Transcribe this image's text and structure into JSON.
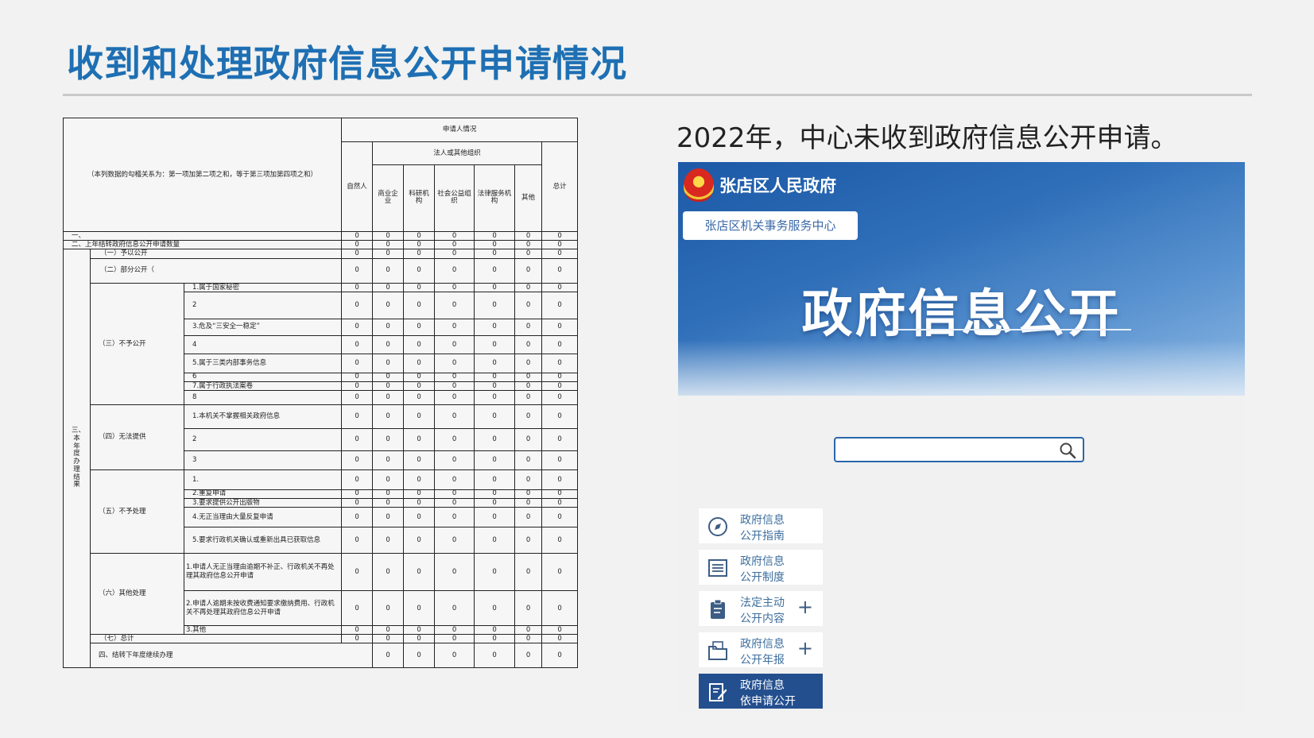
{
  "slide": {
    "title": "收到和处理政府信息公开申请情况",
    "subtitle": "2022年，中心未收到政府信息公开申请。"
  },
  "table": {
    "header": {
      "applicant_situation": "申请人情况",
      "note": "（本列数据的勾稽关系为：第一项加第二项之和，等于第三项加第四项之和）",
      "natural_person": "自然人",
      "legal_group": "法人或其他组织",
      "commercial": "商业企业",
      "research": "科研机构",
      "social": "社会公益组织",
      "legal_service": "法律服务机构",
      "other": "其他",
      "total": "总计"
    },
    "labels": {
      "r1": "一、",
      "r2": "二、上年结转政府信息公开申请数量",
      "section3": "三、本年度办理结果",
      "g1": "（一）予以公开",
      "g2": "（二）部分公开（",
      "g3": "（三）不予公开",
      "g3_1": "1.属于国家秘密",
      "g3_2": "2",
      "g3_3": "3.危及“三安全一稳定”",
      "g3_4": "4",
      "g3_5": "5.属于三类内部事务信息",
      "g3_6": "6",
      "g3_7": "7.属于行政执法案卷",
      "g3_8": "8",
      "g4": "（四）无法提供",
      "g4_1": "1.本机关不掌握相关政府信息",
      "g4_2": "2",
      "g4_3": "3",
      "g5": "（五）不予处理",
      "g5_1": "1.",
      "g5_2": "2.重复申请",
      "g5_3": "3.要求提供公开出版物",
      "g5_4": "4.无正当理由大量反复申请",
      "g5_5": "5.要求行政机关确认或重新出具已获取信息",
      "g6": "（六）其他处理",
      "g6_1": "1.申请人无正当理由逾期不补正、行政机关不再处理其政府信息公开申请",
      "g6_2": "2.申请人逾期未按收费通知要求缴纳费用、行政机关不再处理其政府信息公开申请",
      "g6_3": "3.其他",
      "g7": "（七）总计",
      "r4": "四、结转下年度继续办理"
    },
    "values": {
      "r1": [
        "0",
        "0",
        "0",
        "0",
        "0",
        "0",
        "0"
      ],
      "r2": [
        "0",
        "0",
        "0",
        "0",
        "0",
        "0",
        "0"
      ],
      "g1": [
        "0",
        "0",
        "0",
        "0",
        "0",
        "0",
        "0"
      ],
      "g2": [
        "0",
        "0",
        "0",
        "0",
        "0",
        "0",
        "0"
      ],
      "g3_1": [
        "0",
        "0",
        "0",
        "0",
        "0",
        "0",
        "0"
      ],
      "g3_2": [
        "0",
        "0",
        "0",
        "0",
        "0",
        "0",
        "0"
      ],
      "g3_3": [
        "0",
        "0",
        "0",
        "0",
        "0",
        "0",
        "0"
      ],
      "g3_4": [
        "0",
        "0",
        "0",
        "0",
        "0",
        "0",
        "0"
      ],
      "g3_5": [
        "0",
        "0",
        "0",
        "0",
        "0",
        "0",
        "0"
      ],
      "g3_6": [
        "0",
        "0",
        "0",
        "0",
        "0",
        "0",
        "0"
      ],
      "g3_7": [
        "0",
        "0",
        "0",
        "0",
        "0",
        "0",
        "0"
      ],
      "g3_8": [
        "0",
        "0",
        "0",
        "0",
        "0",
        "0",
        "0"
      ],
      "g4_1": [
        "0",
        "0",
        "0",
        "0",
        "0",
        "0",
        "0"
      ],
      "g4_2": [
        "0",
        "0",
        "0",
        "0",
        "0",
        "0",
        "0"
      ],
      "g4_3": [
        "0",
        "0",
        "0",
        "0",
        "0",
        "0",
        "0"
      ],
      "g5_1": [
        "0",
        "0",
        "0",
        "0",
        "0",
        "0",
        "0"
      ],
      "g5_2": [
        "0",
        "0",
        "0",
        "0",
        "0",
        "0",
        "0"
      ],
      "g5_3": [
        "0",
        "0",
        "0",
        "0",
        "0",
        "0",
        "0"
      ],
      "g5_4": [
        "0",
        "0",
        "0",
        "0",
        "0",
        "0",
        "0"
      ],
      "g5_5": [
        "0",
        "0",
        "0",
        "0",
        "0",
        "0",
        "0"
      ],
      "g6_1": [
        "0",
        "0",
        "0",
        "0",
        "0",
        "0",
        "0"
      ],
      "g6_2": [
        "0",
        "0",
        "0",
        "0",
        "0",
        "0",
        "0"
      ],
      "g6_3": [
        "0",
        "0",
        "0",
        "0",
        "0",
        "0",
        "0"
      ],
      "g7": [
        "0",
        "0",
        "0",
        "0",
        "0",
        "0",
        "0"
      ],
      "r4": [
        "0",
        "0",
        "0",
        "0",
        "0",
        "0",
        "0"
      ]
    }
  },
  "website": {
    "gov_name": "张店区人民政府",
    "org_name": "张店区机关事务服务中心",
    "banner_title": "政府信息公开",
    "search": {
      "placeholder": "",
      "icon": "search-icon"
    },
    "menu": [
      {
        "l1": "政府信息",
        "l2": "公开指南",
        "icon": "compass-icon",
        "plus": "",
        "active": false
      },
      {
        "l1": "政府信息",
        "l2": "公开制度",
        "icon": "list-icon",
        "plus": "",
        "active": false
      },
      {
        "l1": "法定主动",
        "l2": "公开内容",
        "icon": "clipboard-icon",
        "plus": "+",
        "active": false
      },
      {
        "l1": "政府信息",
        "l2": "公开年报",
        "icon": "folder-icon",
        "plus": "+",
        "active": false
      },
      {
        "l1": "政府信息",
        "l2": "依申请公开",
        "icon": "edit-document-icon",
        "plus": "",
        "active": true
      }
    ],
    "colors": {
      "accent": "#1e6fb3",
      "banner": "#2f6fb9",
      "active_menu": "#234f8e"
    }
  }
}
